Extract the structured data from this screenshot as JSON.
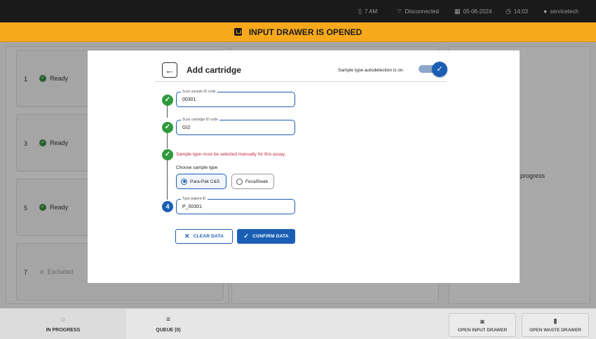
{
  "status_bar": {
    "battery": "7 AM",
    "network": "Disconnected",
    "date": "05-06-2024",
    "time": "14:03",
    "user": "servicetech"
  },
  "banner": {
    "text": "INPUT DRAWER IS OPENED"
  },
  "background": {
    "slots": [
      {
        "number": "1",
        "status": "Ready"
      },
      {
        "number": "3",
        "status": "Ready"
      },
      {
        "number": "5",
        "status": "Ready"
      },
      {
        "number": "7",
        "status": "Excluded"
      }
    ],
    "right_panel_text": "progress"
  },
  "bottom_bar": {
    "tabs": [
      {
        "label": "IN PROGRESS"
      },
      {
        "label": "QUEUE (0)"
      }
    ],
    "buttons": [
      {
        "label": "OPEN INPUT DRAWER"
      },
      {
        "label": "OPEN WASTE DRAWER"
      }
    ]
  },
  "modal": {
    "title": "Add cartridge",
    "autodetect_text": "Sample type autodetection is on.",
    "steps": {
      "sample_id": {
        "label": "Scan sample ID code",
        "value": "00301"
      },
      "cartridge_id": {
        "label": "Scan cartridge ID code",
        "value": "GI2"
      },
      "warning": "Sample type must be selected manually for this assay.",
      "choose_label": "Choose sample type",
      "options": [
        {
          "label": "Para-Pak C&S",
          "selected": true
        },
        {
          "label": "FecalSwab",
          "selected": false
        }
      ],
      "patient": {
        "number": "4",
        "label": "Type patient ID",
        "value": "P_00301"
      }
    },
    "clear_label": "CLEAR DATA",
    "confirm_label": "CONFIRM DATA"
  }
}
